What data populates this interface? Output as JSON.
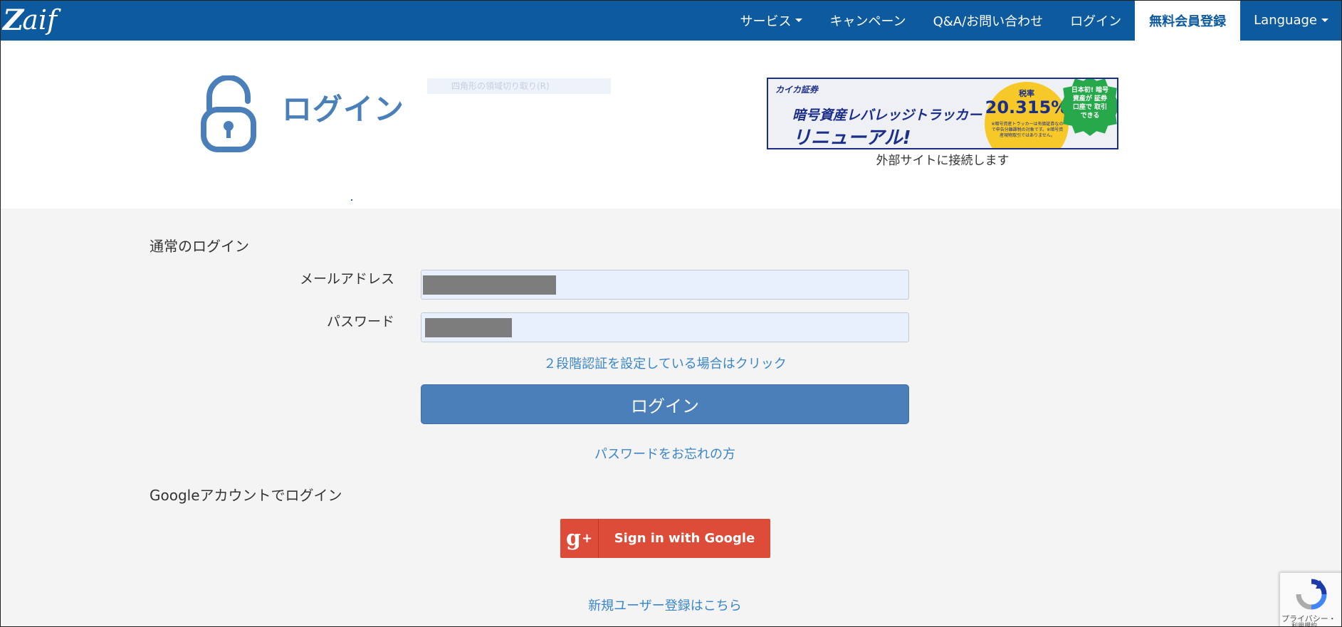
{
  "navbar": {
    "logo_z": "Z",
    "logo_text": "aif",
    "items": [
      {
        "label": "サービス",
        "has_caret": true
      },
      {
        "label": "キャンペーン",
        "has_caret": false
      },
      {
        "label": "Q&A/お問い合わせ",
        "has_caret": false
      },
      {
        "label": "ログイン",
        "has_caret": false
      },
      {
        "label": "無料会員登録",
        "active": true
      },
      {
        "label": "Language",
        "has_caret": true
      }
    ],
    "bg_color": "#0e5a9e"
  },
  "header": {
    "title": "ログイン",
    "faint_box_text": "四角形の領域切り取り(R)"
  },
  "banner": {
    "brand": "カイカ証券",
    "line1": "暗号資産レバレッジトラッカー",
    "line2": "リニューアル!",
    "rate_label": "税率",
    "rate_value": "20.315%",
    "small_text": "※暗号資産トラッカーは有価証券なので申告分離課税の対象です。※暗号資産現物取引ではありません。",
    "badge_text": "日本初! 暗号資産が 証券口座で 取引できる",
    "caption": "外部サイトに接続します"
  },
  "form": {
    "section_title": "通常のログイン",
    "email_label": "メールアドレス",
    "password_label": "パスワード",
    "twofa_link": "２段階認証を設定している場合はクリック",
    "submit_label": "ログイン",
    "forgot_link": "パスワードをお忘れの方"
  },
  "google": {
    "section_title": "Googleアカウントでログイン",
    "button_label": "Sign in with Google",
    "button_icon_text": "g",
    "button_icon_sup": "+",
    "button_color": "#dd4b39"
  },
  "register_link": "新規ユーザー登録はこちら",
  "recaptcha": {
    "privacy": "プライバシー・",
    "terms": "利用規約"
  },
  "colors": {
    "accent": "#4a7fba",
    "link": "#3a86c8"
  }
}
